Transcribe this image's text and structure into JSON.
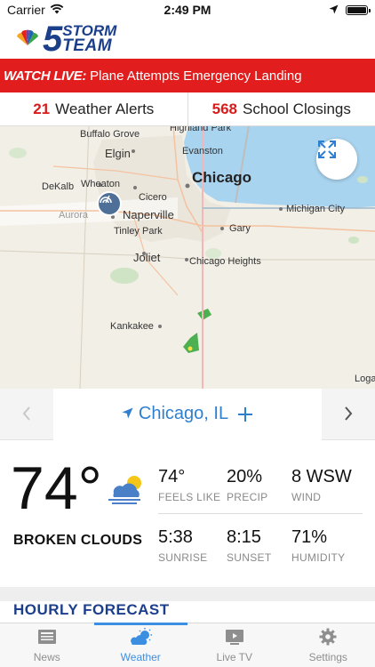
{
  "status_bar": {
    "carrier": "Carrier",
    "time": "2:49 PM",
    "battery_level": 1.0
  },
  "header": {
    "logo_number": "5",
    "logo_line1": "STORM",
    "logo_line2": "TEAM"
  },
  "banner": {
    "tag": "WATCH LIVE:",
    "text": "Plane Attempts Emergency Landing"
  },
  "alerts": {
    "weather_count": "21",
    "weather_label": "Weather Alerts",
    "school_count": "568",
    "school_label": "School Closings"
  },
  "map": {
    "labels": {
      "buffalo_grove": "Buffalo Grove",
      "highland_park": "Highland Park",
      "elgin": "Elgin",
      "evanston": "Evanston",
      "dekalb": "DeKalb",
      "wheaton": "Wheaton",
      "chicago": "Chicago",
      "cicero": "Cicero",
      "aurora": "Aurora",
      "naperville": "Naperville",
      "michigan_city": "Michigan City",
      "tinley_park": "Tinley Park",
      "gary": "Gary",
      "joliet": "Joliet",
      "chicago_heights": "Chicago Heights",
      "kankakee": "Kankakee",
      "logan": "Logan"
    }
  },
  "location": {
    "name": "Chicago, IL"
  },
  "current": {
    "temperature": "74°",
    "condition": "BROKEN CLOUDS",
    "feels_like_value": "74°",
    "feels_like_label": "FEELS LIKE",
    "precip_value": "20%",
    "precip_label": "PRECIP",
    "wind_value": "8 WSW",
    "wind_label": "WIND",
    "sunrise_value": "5:38",
    "sunrise_label": "SUNRISE",
    "sunset_value": "8:15",
    "sunset_label": "SUNSET",
    "humidity_value": "71%",
    "humidity_label": "HUMIDITY"
  },
  "hourly": {
    "title": "HOURLY FORECAST"
  },
  "tabs": [
    {
      "label": "News",
      "icon": "news-icon"
    },
    {
      "label": "Weather",
      "icon": "weather-icon"
    },
    {
      "label": "Live TV",
      "icon": "live-tv-icon"
    },
    {
      "label": "Settings",
      "icon": "settings-icon"
    }
  ],
  "colors": {
    "brand_blue": "#1c3f8c",
    "alert_red": "#e21d1d",
    "accent_blue": "#3c8ee0",
    "lake": "#a9d4ef"
  }
}
